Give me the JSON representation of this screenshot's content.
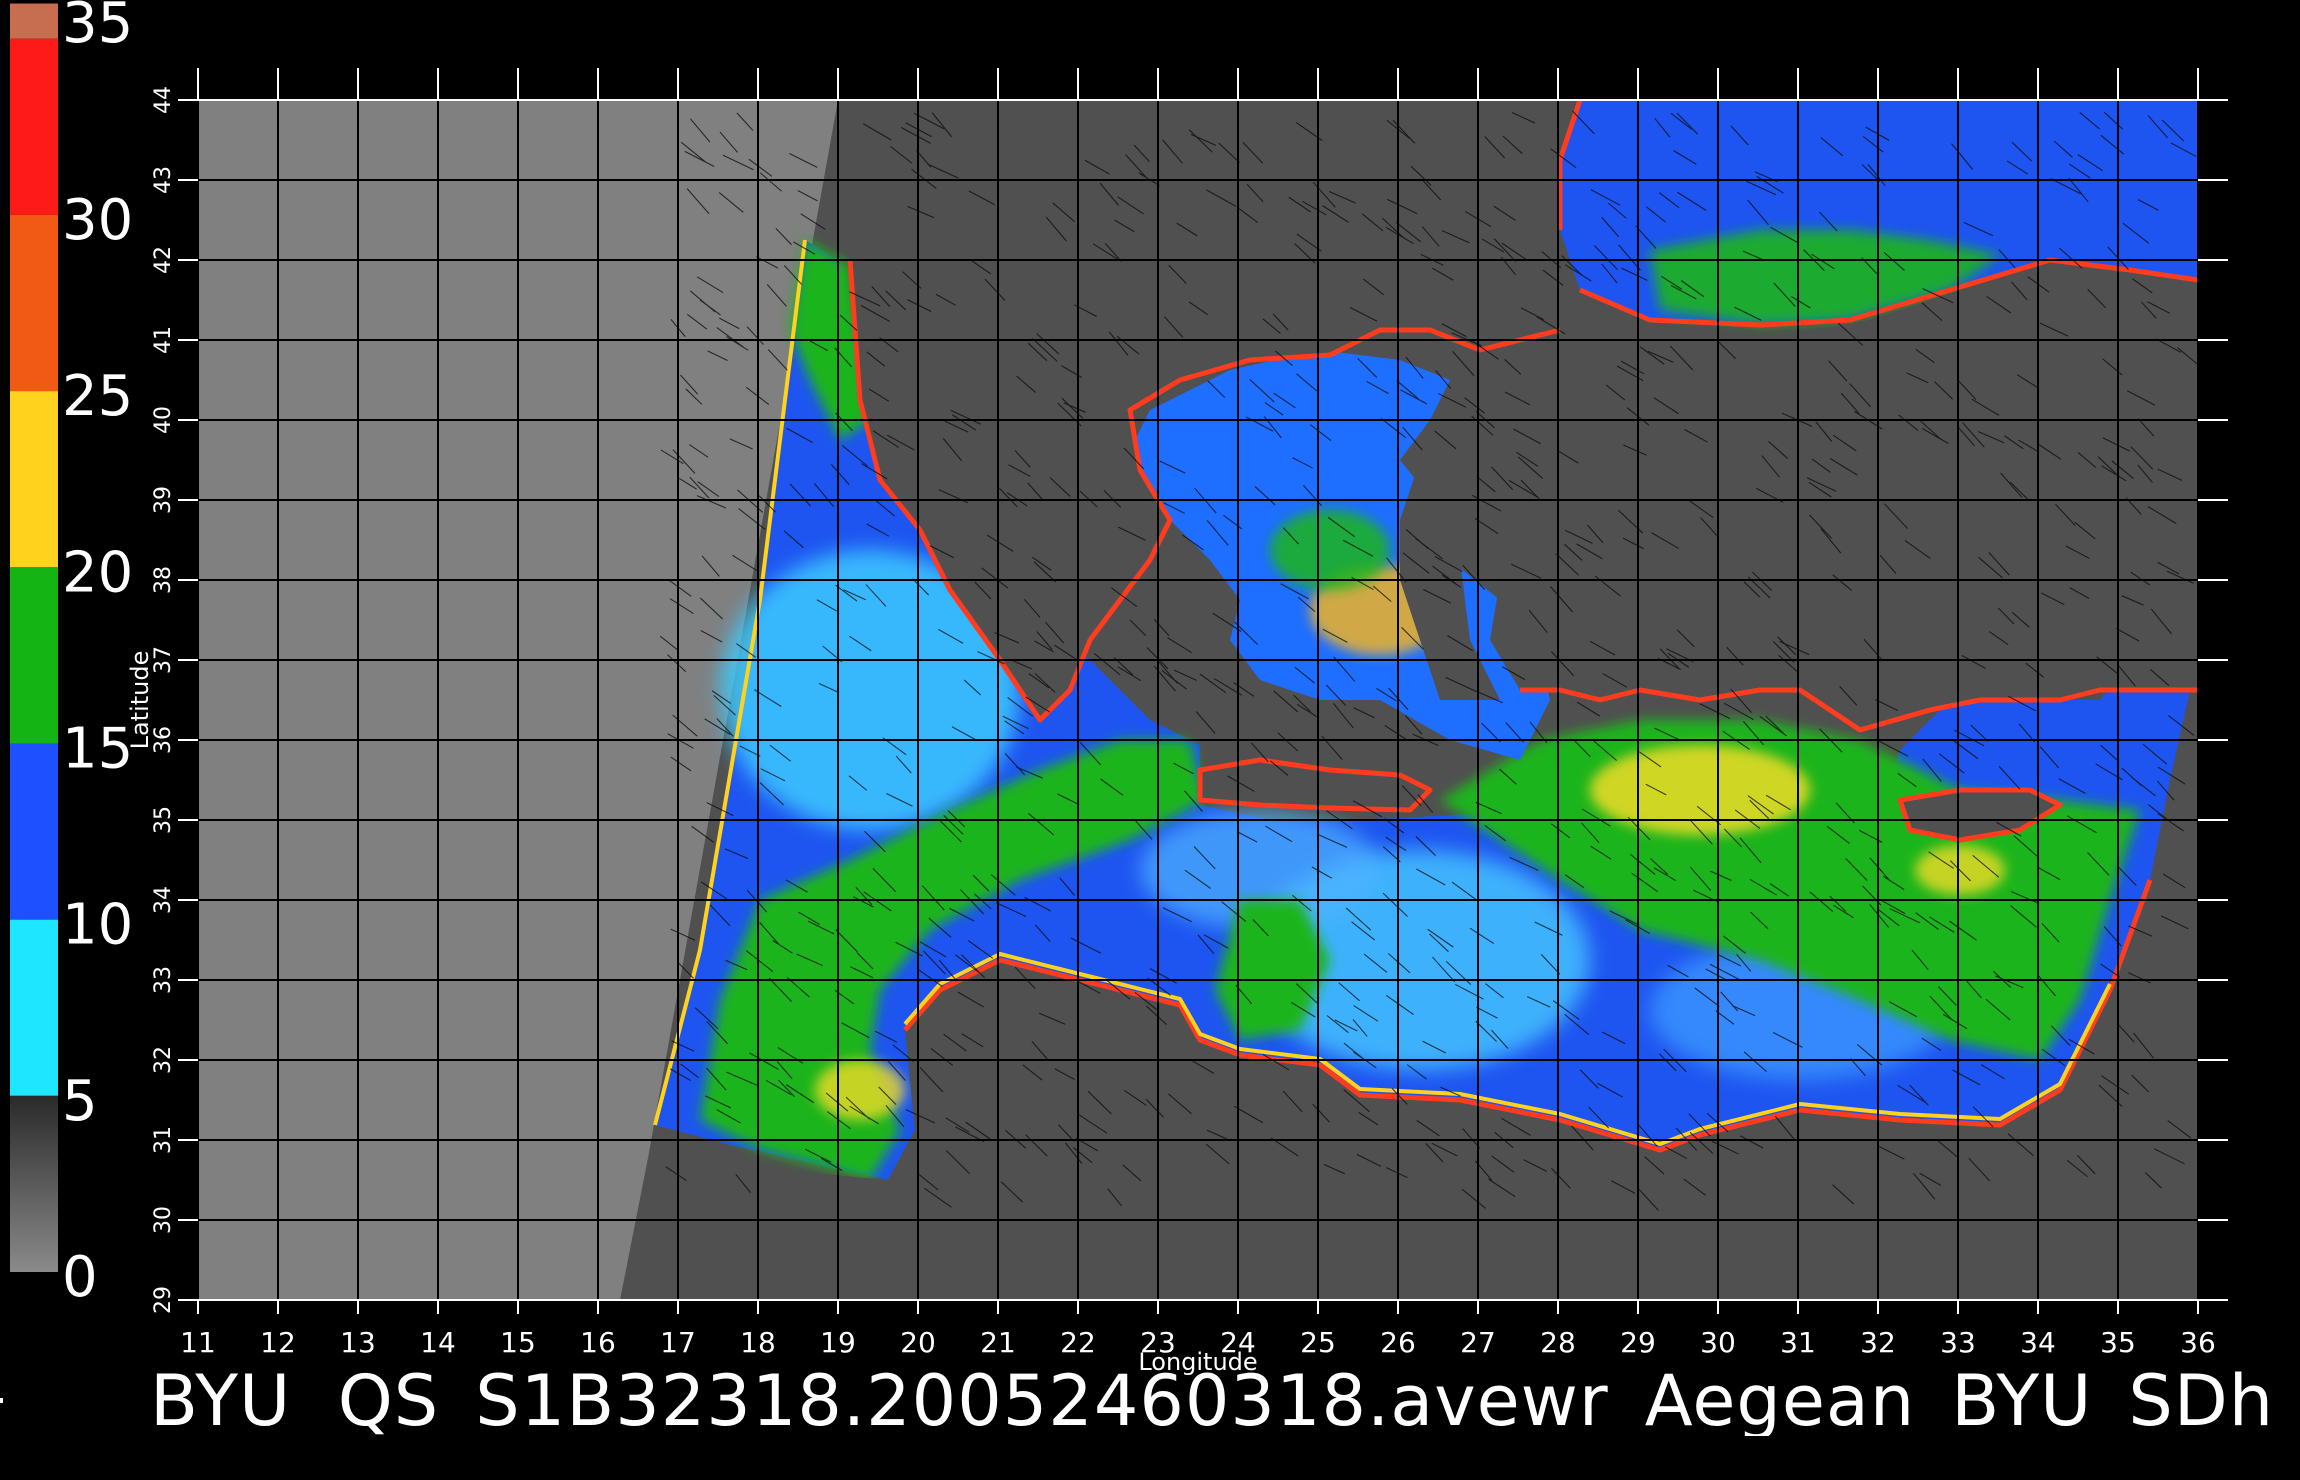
{
  "title": "BYU  QS_S1B32318.20052460318.avewr_Aegean_BYU_SDh",
  "colorbar": {
    "labels": [
      "35",
      "30",
      "25",
      "20",
      "15",
      "10",
      "5",
      "0"
    ],
    "segments": [
      {
        "from": 35,
        "to": 36,
        "color": "#c86e50"
      },
      {
        "from": 30,
        "to": 35,
        "color": "#ff1a1a"
      },
      {
        "from": 25,
        "to": 30,
        "color": "#f05a14"
      },
      {
        "from": 20,
        "to": 25,
        "color": "#ffd21e"
      },
      {
        "from": 15,
        "to": 20,
        "color": "#13b413"
      },
      {
        "from": 10,
        "to": 15,
        "color": "#1e50ff"
      },
      {
        "from": 5,
        "to": 10,
        "color": "#1ee6ff"
      },
      {
        "from": 0,
        "to": 5,
        "color": "#6e6e6e"
      }
    ]
  },
  "axes": {
    "xlabel": "Longitude",
    "ylabel": "Latitude",
    "xticks": [
      "11",
      "12",
      "13",
      "14",
      "15",
      "16",
      "17",
      "18",
      "19",
      "20",
      "21",
      "22",
      "23",
      "24",
      "25",
      "26",
      "27",
      "28",
      "29",
      "30",
      "31",
      "32",
      "33",
      "34",
      "35",
      "36"
    ],
    "yticks": [
      "29",
      "30",
      "31",
      "32",
      "33",
      "34",
      "35",
      "36",
      "37",
      "38",
      "39",
      "40",
      "41",
      "42",
      "43",
      "44"
    ],
    "xlim": [
      11,
      36
    ],
    "ylim": [
      29,
      44
    ],
    "grid": true
  },
  "colors": {
    "background": "#000000",
    "no_data": "#808080",
    "land": "#505050",
    "grid": "#000000",
    "text": "#ffffff"
  }
}
